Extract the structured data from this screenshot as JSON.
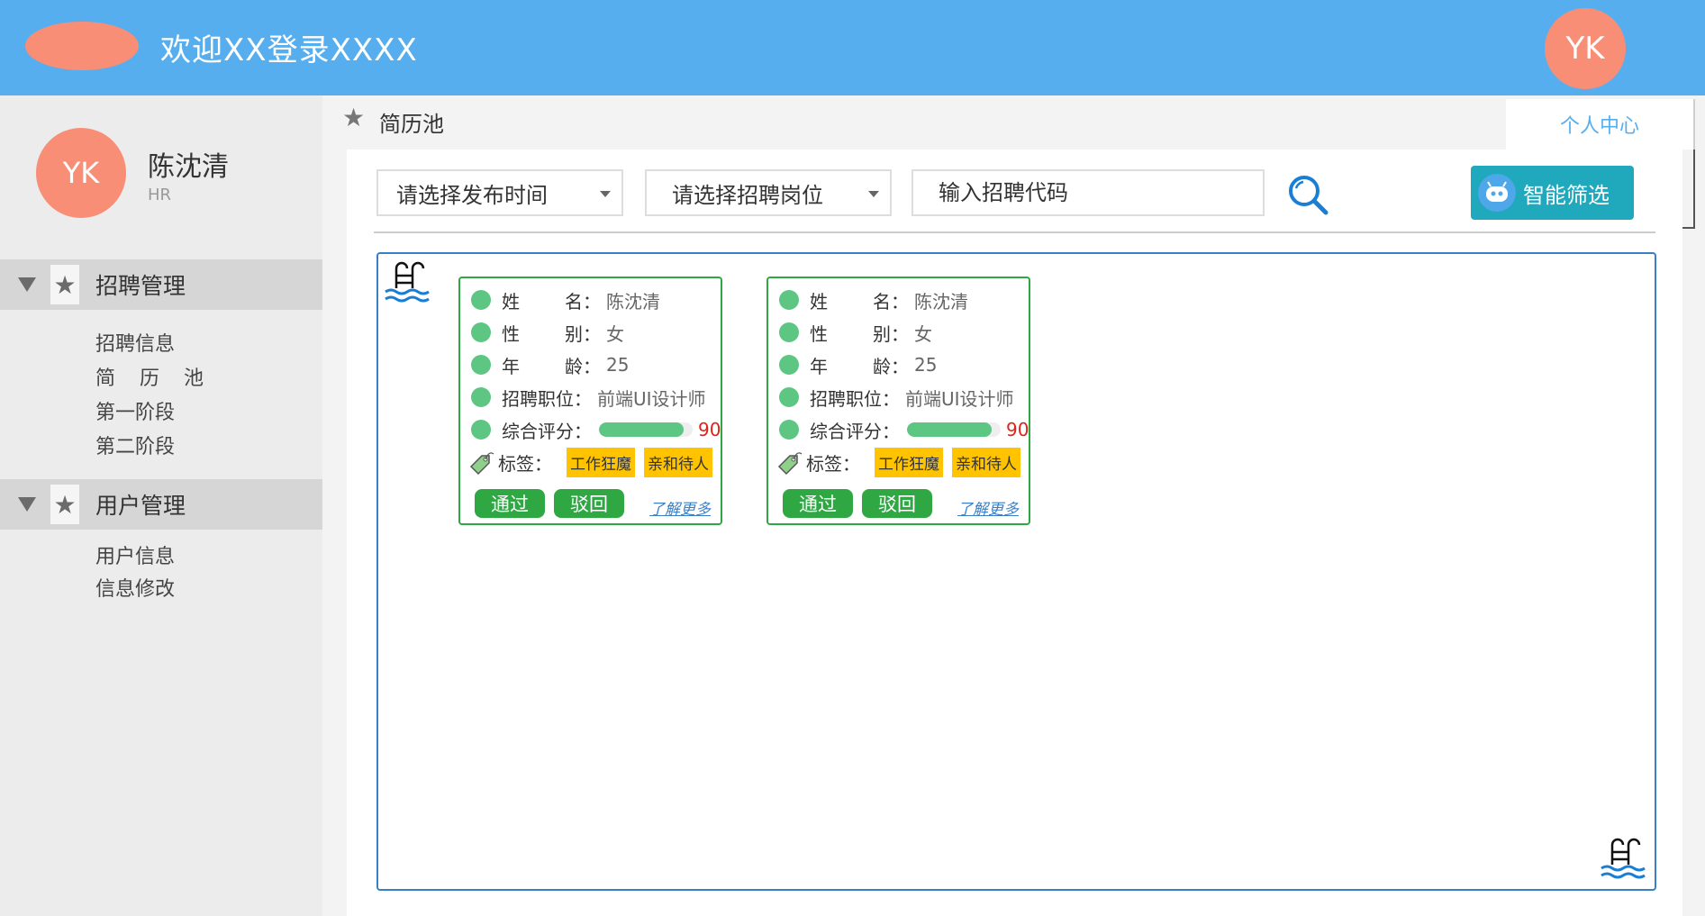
{
  "header": {
    "title": "欢迎XX登录XXXX",
    "avatar_text": "YK"
  },
  "user": {
    "avatar_text": "YK",
    "name": "陈沈清",
    "role": "HR"
  },
  "sidebar": {
    "groups": [
      {
        "label": "招聘管理",
        "items": [
          "招聘信息",
          "简 历 池",
          "第一阶段",
          "第二阶段"
        ]
      },
      {
        "label": "用户管理",
        "items": [
          "用户信息",
          "信息修改"
        ]
      }
    ]
  },
  "breadcrumb": {
    "title": "简历池"
  },
  "tabs": {
    "personal_center": "个人中心"
  },
  "filters": {
    "publish_time_placeholder": "请选择发布时间",
    "position_placeholder": "请选择招聘岗位",
    "code_placeholder": "输入招聘代码",
    "smart_filter_label": "智能筛选"
  },
  "labels": {
    "name": [
      "姓",
      "名"
    ],
    "gender": [
      "性",
      "别"
    ],
    "age": [
      "年",
      "龄"
    ],
    "position": "招聘职位",
    "score": "综合评分",
    "tags": "标签",
    "colon": "：",
    "pass": "通过",
    "reject": "驳回",
    "more": "了解更多"
  },
  "candidates": [
    {
      "name": "陈沈清",
      "gender": "女",
      "age": "25",
      "position": "前端UI设计师",
      "score": 90,
      "tags": [
        "工作狂魔",
        "亲和待人"
      ]
    },
    {
      "name": "陈沈清",
      "gender": "女",
      "age": "25",
      "position": "前端UI设计师",
      "score": 90,
      "tags": [
        "工作狂魔",
        "亲和待人"
      ]
    }
  ],
  "colors": {
    "header": "#57aeee",
    "accent_green": "#2fa844",
    "tag_yellow": "#ffc300",
    "avatar": "#f98e77",
    "smart_button": "#20a9bd"
  }
}
